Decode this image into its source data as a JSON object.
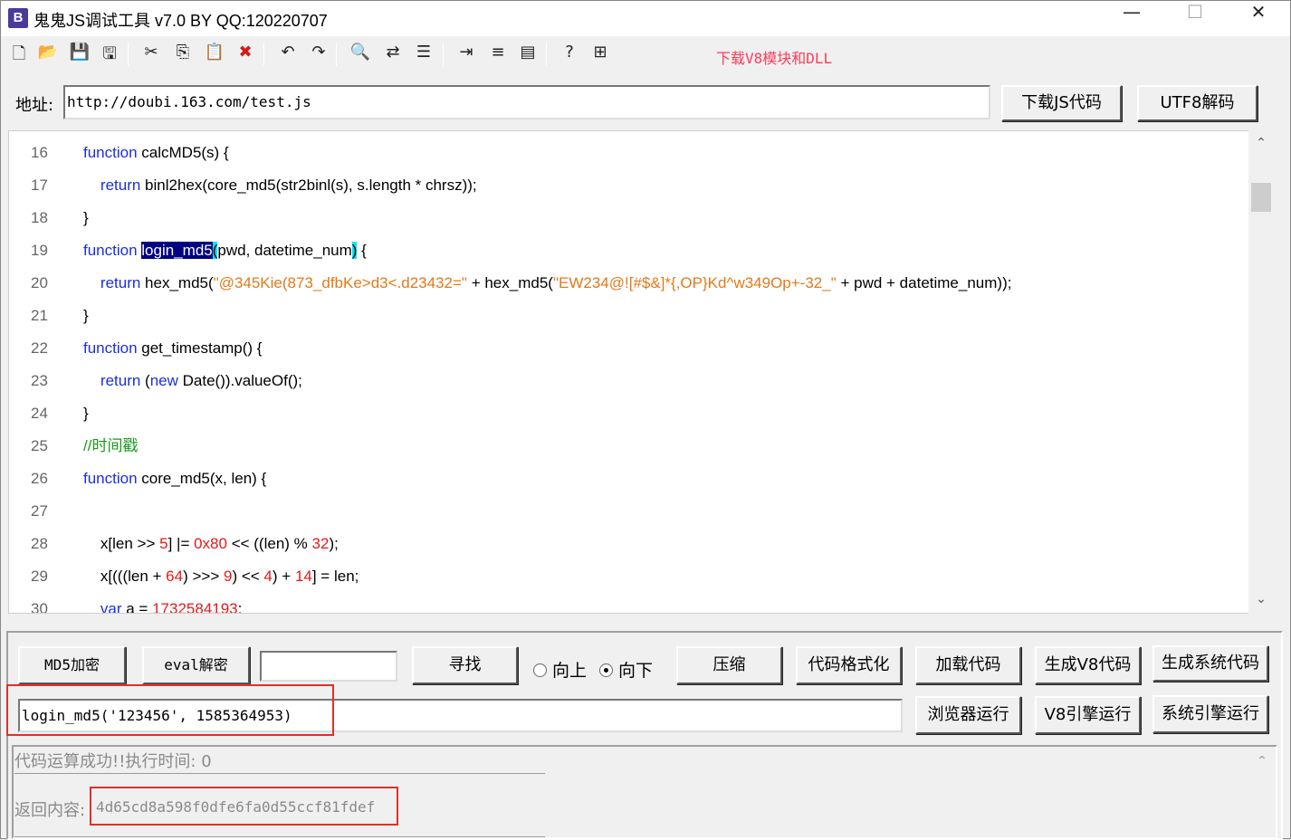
{
  "window": {
    "app_icon_letter": "B",
    "title": "鬼鬼JS调试工具 v7.0 BY QQ:120220707",
    "minimize_glyph": "—",
    "maximize_glyph": "☐",
    "close_glyph": "✕"
  },
  "toolbar": {
    "icons": [
      {
        "name": "new-file-icon",
        "glyph": "🗋"
      },
      {
        "name": "open-folder-icon",
        "glyph": "📂"
      },
      {
        "name": "save-icon",
        "glyph": "💾"
      },
      {
        "name": "save-all-icon",
        "glyph": "🖫"
      },
      {
        "name": "cut-icon",
        "glyph": "✂"
      },
      {
        "name": "copy-icon",
        "glyph": "⎘"
      },
      {
        "name": "paste-icon",
        "glyph": "📋"
      },
      {
        "name": "delete-icon",
        "glyph": "✖"
      },
      {
        "name": "undo-icon",
        "glyph": "↶"
      },
      {
        "name": "redo-icon",
        "glyph": "↷"
      },
      {
        "name": "find-icon",
        "glyph": "🔍"
      },
      {
        "name": "replace-icon",
        "glyph": "⇄"
      },
      {
        "name": "bookmark-list-icon",
        "glyph": "☰"
      },
      {
        "name": "indent-icon",
        "glyph": "⇥"
      },
      {
        "name": "numbered-list-icon",
        "glyph": "≡"
      },
      {
        "name": "window-icon",
        "glyph": "▤"
      },
      {
        "name": "help-cursor-icon",
        "glyph": "?"
      },
      {
        "name": "properties-icon",
        "glyph": "⊞"
      }
    ],
    "download_link": "下载V8模块和DLL"
  },
  "address": {
    "label": "地址:",
    "value": "http://doubi.163.com/test.js",
    "download_js_button": "下载JS代码",
    "utf8_decode_button": "UTF8解码"
  },
  "editor": {
    "lines": [
      {
        "no": "16",
        "tokens": [
          {
            "t": "function",
            "c": "kw"
          },
          {
            "t": " calcMD5(s) {"
          }
        ]
      },
      {
        "no": "17",
        "tokens": [
          {
            "t": "    "
          },
          {
            "t": "return",
            "c": "kw"
          },
          {
            "t": " binl2hex(core_md5(str2binl(s), s.length * chrsz));"
          }
        ]
      },
      {
        "no": "18",
        "tokens": [
          {
            "t": "}"
          }
        ]
      },
      {
        "no": "19",
        "tokens": [
          {
            "t": "function",
            "c": "kw"
          },
          {
            "t": " "
          },
          {
            "t": "login_md5",
            "c": "sel"
          },
          {
            "t": "(",
            "c": "brace-hl"
          },
          {
            "t": "pwd, datetime_num"
          },
          {
            "t": ")",
            "c": "brace-hl"
          },
          {
            "t": " {"
          }
        ]
      },
      {
        "no": "20",
        "tokens": [
          {
            "t": "    "
          },
          {
            "t": "return",
            "c": "kw"
          },
          {
            "t": " hex_md5("
          },
          {
            "t": "\"@345Kie(873_dfbKe>d3<.d23432=\"",
            "c": "str"
          },
          {
            "t": " + hex_md5("
          },
          {
            "t": "\"EW234@![#$&]*{,OP}Kd^w349Op+-32_\"",
            "c": "str"
          },
          {
            "t": " + pwd + datetime_num));"
          }
        ]
      },
      {
        "no": "21",
        "tokens": [
          {
            "t": "}"
          }
        ]
      },
      {
        "no": "22",
        "tokens": [
          {
            "t": "function",
            "c": "kw"
          },
          {
            "t": " get_timestamp() {"
          }
        ]
      },
      {
        "no": "23",
        "tokens": [
          {
            "t": "    "
          },
          {
            "t": "return",
            "c": "kw"
          },
          {
            "t": " ("
          },
          {
            "t": "new",
            "c": "kw"
          },
          {
            "t": " Date()).valueOf();"
          }
        ]
      },
      {
        "no": "24",
        "tokens": [
          {
            "t": "}"
          }
        ]
      },
      {
        "no": "25",
        "tokens": [
          {
            "t": "//时间戳",
            "c": "cmt"
          }
        ]
      },
      {
        "no": "26",
        "tokens": [
          {
            "t": "function",
            "c": "kw"
          },
          {
            "t": " core_md5(x, len) {"
          }
        ]
      },
      {
        "no": "27",
        "tokens": []
      },
      {
        "no": "28",
        "tokens": [
          {
            "t": "    x[len >> "
          },
          {
            "t": "5",
            "c": "num"
          },
          {
            "t": "] |= "
          },
          {
            "t": "0x80",
            "c": "num"
          },
          {
            "t": " << ((len) % "
          },
          {
            "t": "32",
            "c": "num"
          },
          {
            "t": ");"
          }
        ]
      },
      {
        "no": "29",
        "tokens": [
          {
            "t": "    x[(((len + "
          },
          {
            "t": "64",
            "c": "num"
          },
          {
            "t": ") >>> "
          },
          {
            "t": "9",
            "c": "num"
          },
          {
            "t": ") << "
          },
          {
            "t": "4",
            "c": "num"
          },
          {
            "t": ") + "
          },
          {
            "t": "14",
            "c": "num"
          },
          {
            "t": "] = len;"
          }
        ]
      },
      {
        "no": "30",
        "tokens": [
          {
            "t": "    "
          },
          {
            "t": "var",
            "c": "kw"
          },
          {
            "t": " a = "
          },
          {
            "t": "1732584193",
            "c": "num"
          },
          {
            "t": ";"
          }
        ]
      }
    ],
    "scroll_up_glyph": "⌃",
    "scroll_down_glyph": "⌄"
  },
  "controls": {
    "md5_button": "MD5加密",
    "eval_button": "eval解密",
    "search_value": "",
    "find_button": "寻找",
    "radio_up": "向上",
    "radio_down": "向下",
    "compress_button": "压缩",
    "format_button": "代码格式化",
    "load_button": "加载代码",
    "gen_v8_button": "生成V8代码",
    "gen_sys_button": "生成系统代码",
    "expression": "login_md5('123456', 1585364953)",
    "browser_run_button": "浏览器运行",
    "v8_run_button": "V8引擎运行",
    "sys_run_button": "系统引擎运行"
  },
  "result": {
    "status": "代码运算成功!!执行时间: 0",
    "return_label": "返回内容:",
    "return_value": "4d65cd8a598f0dfe6fa0d55ccf81fdef",
    "scroll_up_glyph": "⌃"
  },
  "annotation_color": "#e0302a"
}
